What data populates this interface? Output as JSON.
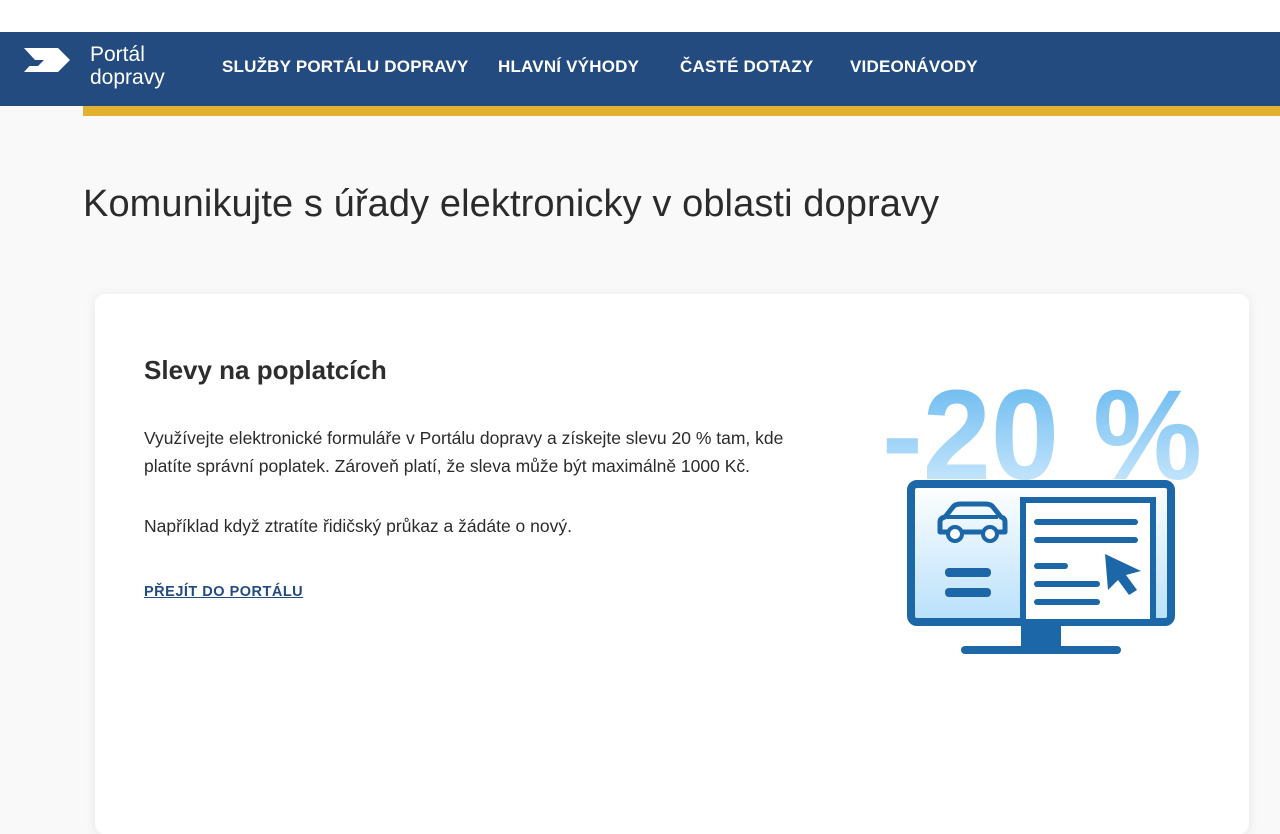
{
  "header": {
    "logo_line1": "Portál",
    "logo_line2": "dopravy",
    "nav": [
      {
        "label": "SLUŽBY PORTÁLU DOPRAVY"
      },
      {
        "label": "HLAVNÍ VÝHODY"
      },
      {
        "label": "ČASTÉ DOTAZY"
      },
      {
        "label": "VIDEONÁVODY"
      }
    ]
  },
  "main": {
    "title": "Komunikujte s úřady elektronicky v oblasti dopravy",
    "card": {
      "heading": "Slevy na poplatcích",
      "paragraph1": "Využívejte elektronické formuláře v Portálu dopravy a získejte slevu 20 % tam, kde platíte správní poplatek. Zároveň platí, že sleva může být maximálně 1000 Kč.",
      "paragraph2": "Například když ztratíte řidičský průkaz a žádáte o nový.",
      "link_label": "PŘEJÍT DO PORTÁLU",
      "illustration_text": "-20 %"
    }
  },
  "colors": {
    "nav_background": "#234b80",
    "accent": "#e2b12f",
    "link": "#234b80",
    "illustration_primary": "#1c67a8",
    "illustration_light": "#a9d7f5"
  }
}
